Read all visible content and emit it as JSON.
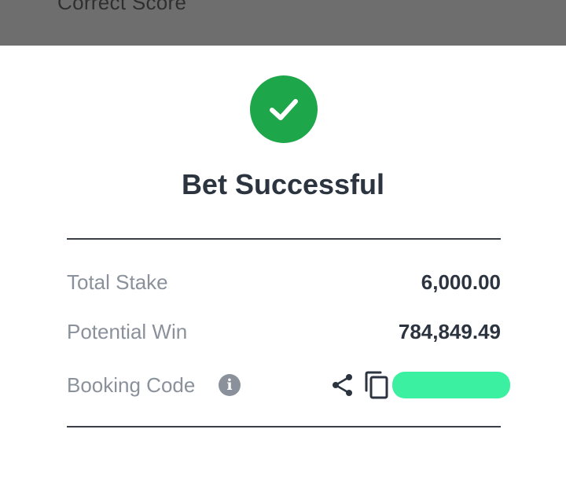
{
  "background": {
    "partial_text": "Correct Score"
  },
  "dialog": {
    "title": "Bet Successful",
    "success_color": "#1ea64a",
    "icon": "check-icon",
    "rows": [
      {
        "label": "Total Stake",
        "value": "6,000.00"
      },
      {
        "label": "Potential Win",
        "value": "784,849.49"
      }
    ],
    "booking": {
      "label": "Booking Code",
      "info_icon": "info-icon",
      "share_icon": "share-icon",
      "copy_icon": "copy-icon",
      "code_redacted_color": "#3bf0a0"
    }
  }
}
